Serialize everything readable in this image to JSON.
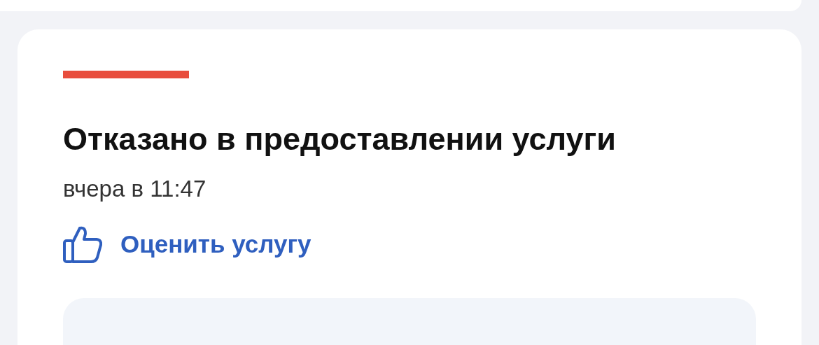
{
  "card": {
    "kind": "rejected",
    "title": "Отказано в предоставлении услуги",
    "time": "вчера в 11:47",
    "rate_link": "Оценить услугу"
  }
}
